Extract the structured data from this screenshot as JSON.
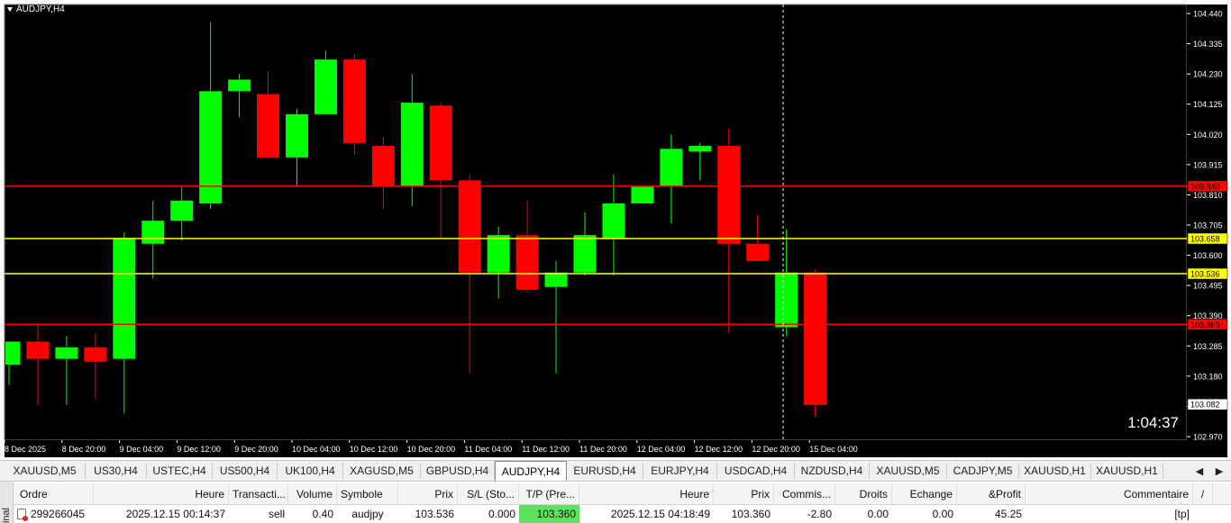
{
  "chart": {
    "title": "AUDJPY,H4",
    "timer": "1:04:37",
    "price_axis": [
      "104.440",
      "104.335",
      "104.230",
      "104.125",
      "104.020",
      "103.915",
      "103.810",
      "103.705",
      "103.600",
      "103.495",
      "103.390",
      "103.285",
      "103.180",
      "103.075",
      "102.970"
    ],
    "price_tags": [
      {
        "text": "103.840",
        "price": 103.84,
        "color": "#ff0000",
        "fill": "#ff0000",
        "textColor": "#000000"
      },
      {
        "text": "103.658",
        "price": 103.658,
        "color": "#ffff00",
        "fill": "#ffff00",
        "textColor": "#000000"
      },
      {
        "text": "103.536",
        "price": 103.536,
        "color": "#ffff00",
        "fill": "#ffff00",
        "textColor": "#000000"
      },
      {
        "text": "103.360",
        "price": 103.36,
        "color": "#ff0000",
        "fill": "#ff0000",
        "textColor": "#000000"
      },
      {
        "text": "103.082",
        "price": 103.082,
        "color": "#ffffff",
        "fill": "#ffffff",
        "textColor": "#000000"
      }
    ],
    "time_axis": [
      "8 Dec 2025",
      "8 Dec 20:00",
      "9 Dec 04:00",
      "9 Dec 12:00",
      "9 Dec 20:00",
      "10 Dec 04:00",
      "10 Dec 12:00",
      "10 Dec 20:00",
      "11 Dec 04:00",
      "11 Dec 12:00",
      "11 Dec 20:00",
      "12 Dec 04:00",
      "12 Dec 12:00",
      "12 Dec 20:00",
      "15 Dec 04:00"
    ],
    "colors": {
      "background": "#000000",
      "bull": "#00ff00",
      "bear": "#ff0000",
      "axis": "#ffffff",
      "cursor": "#ffffff"
    }
  },
  "chart_data": {
    "type": "candlestick",
    "title": "AUDJPY,H4",
    "ylim": [
      102.97,
      104.44
    ],
    "candles": [
      {
        "o": 103.22,
        "h": 103.3,
        "l": 103.15,
        "c": 103.3
      },
      {
        "o": 103.3,
        "h": 103.36,
        "l": 103.08,
        "c": 103.24
      },
      {
        "o": 103.24,
        "h": 103.32,
        "l": 103.08,
        "c": 103.28
      },
      {
        "o": 103.28,
        "h": 103.33,
        "l": 103.1,
        "c": 103.23
      },
      {
        "o": 103.24,
        "h": 103.68,
        "l": 103.05,
        "c": 103.66
      },
      {
        "o": 103.64,
        "h": 103.79,
        "l": 103.52,
        "c": 103.72
      },
      {
        "o": 103.72,
        "h": 103.84,
        "l": 103.65,
        "c": 103.79
      },
      {
        "o": 103.78,
        "h": 104.41,
        "l": 103.76,
        "c": 104.17
      },
      {
        "o": 104.17,
        "h": 104.23,
        "l": 104.08,
        "c": 104.21
      },
      {
        "o": 104.16,
        "h": 104.24,
        "l": 103.95,
        "c": 103.94
      },
      {
        "o": 103.94,
        "h": 104.11,
        "l": 103.84,
        "c": 104.09
      },
      {
        "o": 104.09,
        "h": 104.31,
        "l": 104.09,
        "c": 104.28
      },
      {
        "o": 104.28,
        "h": 104.3,
        "l": 103.95,
        "c": 103.99
      },
      {
        "o": 103.98,
        "h": 104.01,
        "l": 103.76,
        "c": 103.84
      },
      {
        "o": 103.84,
        "h": 104.23,
        "l": 103.77,
        "c": 104.13
      },
      {
        "o": 104.12,
        "h": 104.13,
        "l": 103.66,
        "c": 103.86
      },
      {
        "o": 103.86,
        "h": 103.88,
        "l": 103.19,
        "c": 103.54
      },
      {
        "o": 103.54,
        "h": 103.7,
        "l": 103.45,
        "c": 103.67
      },
      {
        "o": 103.67,
        "h": 103.79,
        "l": 103.47,
        "c": 103.48
      },
      {
        "o": 103.49,
        "h": 103.58,
        "l": 103.19,
        "c": 103.54
      },
      {
        "o": 103.54,
        "h": 103.75,
        "l": 103.53,
        "c": 103.67
      },
      {
        "o": 103.66,
        "h": 103.88,
        "l": 103.53,
        "c": 103.78
      },
      {
        "o": 103.78,
        "h": 103.84,
        "l": 103.79,
        "c": 103.84
      },
      {
        "o": 103.84,
        "h": 104.02,
        "l": 103.71,
        "c": 103.97
      },
      {
        "o": 103.96,
        "h": 103.99,
        "l": 103.86,
        "c": 103.98
      },
      {
        "o": 103.98,
        "h": 104.04,
        "l": 103.33,
        "c": 103.64
      },
      {
        "o": 103.64,
        "h": 103.74,
        "l": 103.58,
        "c": 103.58
      },
      {
        "o": 103.35,
        "h": 103.69,
        "l": 103.32,
        "c": 103.54
      },
      {
        "o": 103.54,
        "h": 103.55,
        "l": 103.04,
        "c": 103.08
      }
    ]
  },
  "tabs": {
    "items": [
      "XAUUSD,M5",
      "US30,H4",
      "USTEC,H4",
      "US500,H4",
      "UK100,H4",
      "XAGUSD,M5",
      "GBPUSD,H4",
      "AUDJPY,H4",
      "EURUSD,H4",
      "EURJPY,H4",
      "USDCAD,H4",
      "NZDUSD,H4",
      "XAUUSD,M5",
      "CADJPY,M5",
      "XAUUSD,H1",
      "XAUUSD,H1"
    ],
    "active": 7,
    "arrow_left": "◀",
    "arrow_right": "▶"
  },
  "terminal": {
    "side_label": "inal",
    "headers": [
      "Ordre",
      "Heure",
      "Transacti...",
      "Volume",
      "Symbole",
      "Prix",
      "S/L (Sto...",
      "T/P (Pre...",
      "Heure",
      "Prix",
      "Commis...",
      "Droits",
      "Echange",
      "&Profit",
      "Commentaire",
      "/"
    ],
    "row": {
      "ordre": "299266045",
      "heure": "2025.12.15 00:14:37",
      "transaction": "sell",
      "volume": "0.40",
      "symbole": "audjpy",
      "prix": "103.536",
      "sl": "0.000",
      "tp": "103.360",
      "heure2": "2025.12.15 04:18:49",
      "prix2": "103.360",
      "commission": "-2.80",
      "droits": "0.00",
      "echange": "0.00",
      "profit": "45.25",
      "commentaire": "[tp]"
    }
  }
}
